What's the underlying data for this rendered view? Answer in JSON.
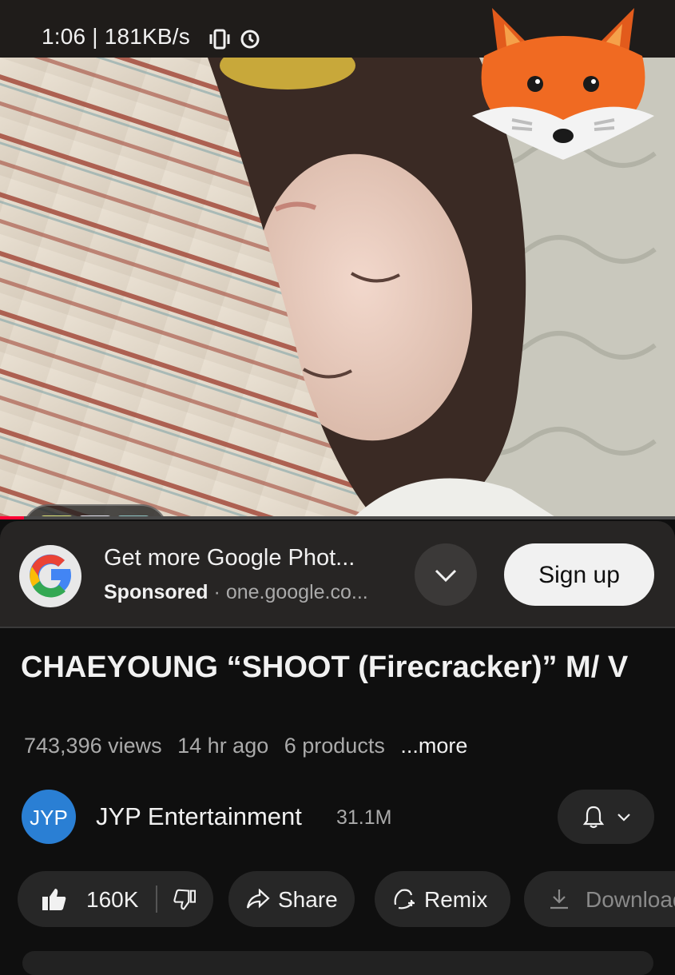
{
  "status_bar": {
    "time_speed": "1:06 | 181KB/s"
  },
  "player": {
    "progress_fraction": 0.035,
    "chapter_thumbs": 3
  },
  "ad": {
    "title": "Get more Google Phot...",
    "sponsored_label": "Sponsored",
    "domain": "one.google.co...",
    "signup_label": "Sign up"
  },
  "video": {
    "title": "CHAEYOUNG “SHOOT (Firecracker)” M/ V",
    "views": "743,396 views",
    "age": "14 hr ago",
    "products": "6 products",
    "more_label": "...more"
  },
  "channel": {
    "name": "JYP Entertainment",
    "subscribers": "31.1M",
    "avatar_text": "JYP"
  },
  "actions": {
    "likes": "160K",
    "share_label": "Share",
    "remix_label": "Remix",
    "download_label": "Download"
  },
  "colors": {
    "background": "#0f0f0f",
    "progress": "#ff0033",
    "signup_bg": "#f1f1f1"
  },
  "icons": [
    "signal-icon",
    "vibrate-icon",
    "alarm-icon",
    "google-logo",
    "chevron-down-icon",
    "bell-icon",
    "like-icon",
    "dislike-icon",
    "share-icon",
    "remix-icon",
    "download-icon",
    "fox-sticker"
  ]
}
